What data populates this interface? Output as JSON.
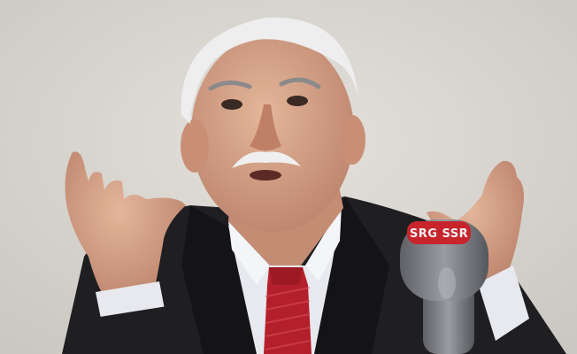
{
  "photo": {
    "microphone": {
      "brand_text": "SRG SSR"
    },
    "colors": {
      "background": "#d9d6d1",
      "suit": "#1f1f22",
      "shirt": "#e8e9ee",
      "tie": "#b3202b",
      "skin": "#d8a88c",
      "hair": "#eeeeee",
      "mic_body": "#7d7f85",
      "mic_badge": "#c8242c"
    }
  }
}
